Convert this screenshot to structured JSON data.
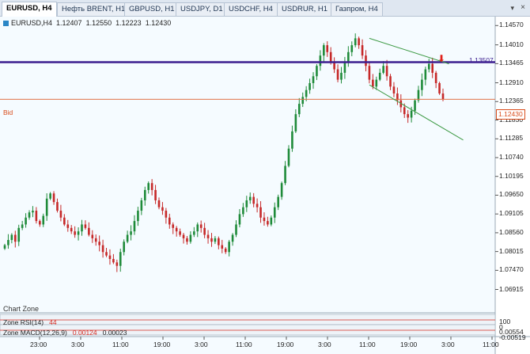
{
  "tabs": [
    {
      "label": "EURUSD, H4",
      "active": true
    },
    {
      "label": "Нефть BRENT, H1",
      "active": false
    },
    {
      "label": "GBPUSD, H1",
      "active": false
    },
    {
      "label": "USDJPY, D1",
      "active": false
    },
    {
      "label": "USDCHF, H4",
      "active": false
    },
    {
      "label": "USDRUR, H1",
      "active": false
    },
    {
      "label": "Газпром, H4",
      "active": false
    }
  ],
  "tab_menu_icon": "chevron-down-icon",
  "tab_close_icon": "close-icon",
  "chart_info": {
    "symbol": "EURUSD,H4",
    "open": "1.12407",
    "high": "1.12550",
    "low": "1.12223",
    "close": "1.12430"
  },
  "bid_label": "Bid",
  "bid_tag": "1.12430",
  "level_tag": "1.13507",
  "chart_zone_label": "Chart Zone",
  "indicators": {
    "rsi": {
      "zone": "Zone",
      "name": "RSI(14)",
      "value": "44"
    },
    "macd": {
      "zone": "Zone",
      "name": "MACD(12,26,9)",
      "value1": "0.00124",
      "value2": "0.00023"
    },
    "rsi_scale": [
      "100",
      "0"
    ],
    "macd_scale": [
      "0.00554",
      "-0.00519"
    ]
  },
  "colors": {
    "bg": "#f5fbff",
    "bull": "#1f8b3a",
    "bear": "#c62828",
    "level": "#3b1d8f",
    "bid": "#e0734a",
    "channel": "#3d9a44",
    "arrow": "#e0201a"
  },
  "chart_data": {
    "type": "candlestick",
    "title": "EURUSD, H4",
    "y_ticks": [
      "1.14570",
      "1.14010",
      "1.13465",
      "1.12910",
      "1.12365",
      "1.11830",
      "1.11285",
      "1.10740",
      "1.10195",
      "1.09650",
      "1.09105",
      "1.08560",
      "1.08015",
      "1.07470",
      "1.06915"
    ],
    "ylim": [
      1.0672,
      1.1476
    ],
    "x_ticks": [
      "23:00",
      "3:00",
      "11:00",
      "19:00",
      "3:00",
      "11:00",
      "19:00",
      "3:00",
      "11:00",
      "19:00",
      "3:00",
      "11:00"
    ],
    "horizontal_level": 1.13507,
    "bid": 1.1243,
    "channel_upper": [
      [
        1.142,
        1.1346
      ]
    ],
    "channel_lower": [
      [
        1.1285,
        1.1125
      ]
    ],
    "closes": [
      1.082,
      1.0835,
      1.085,
      1.083,
      1.087,
      1.088,
      1.09,
      1.0915,
      1.092,
      1.089,
      1.088,
      1.0905,
      1.0955,
      1.097,
      1.0945,
      1.092,
      1.09,
      1.088,
      1.087,
      1.086,
      1.085,
      1.086,
      1.088,
      1.087,
      1.085,
      1.084,
      1.083,
      1.082,
      1.08,
      1.079,
      1.078,
      1.077,
      1.076,
      1.08,
      1.083,
      1.085,
      1.086,
      1.089,
      1.092,
      1.095,
      1.098,
      1.1,
      1.098,
      1.095,
      1.093,
      1.092,
      1.09,
      1.088,
      1.087,
      1.086,
      1.085,
      1.084,
      1.083,
      1.085,
      1.086,
      1.088,
      1.087,
      1.085,
      1.084,
      1.083,
      1.084,
      1.082,
      1.081,
      1.08,
      1.083,
      1.085,
      1.088,
      1.091,
      1.093,
      1.095,
      1.096,
      1.094,
      1.093,
      1.09,
      1.089,
      1.088,
      1.09,
      1.093,
      1.096,
      1.1,
      1.105,
      1.11,
      1.115,
      1.12,
      1.123,
      1.125,
      1.127,
      1.129,
      1.131,
      1.134,
      1.137,
      1.14,
      1.138,
      1.135,
      1.133,
      1.13,
      1.132,
      1.135,
      1.138,
      1.14,
      1.142,
      1.14,
      1.137,
      1.134,
      1.13,
      1.128,
      1.13,
      1.132,
      1.134,
      1.131,
      1.128,
      1.126,
      1.124,
      1.122,
      1.12,
      1.119,
      1.121,
      1.124,
      1.127,
      1.13,
      1.133,
      1.1346,
      1.132,
      1.129,
      1.126,
      1.1243
    ]
  }
}
